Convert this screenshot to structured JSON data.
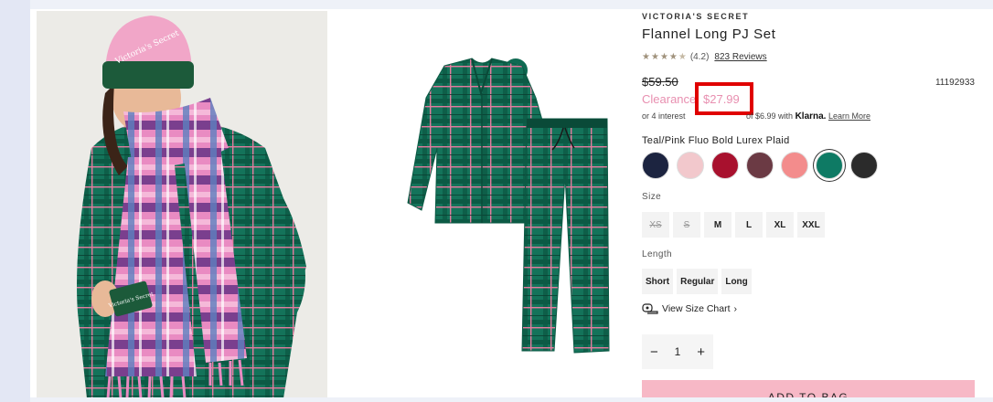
{
  "product": {
    "brand": "VICTORIA'S SECRET",
    "title": "Flannel Long PJ Set",
    "rating_value": 4.2,
    "rating_text": "(4.2)",
    "reviews_link": "823 Reviews",
    "original_price": "$59.50",
    "sku": "11192933",
    "clearance_label": "Clearance",
    "sale_price": "$27.99",
    "klarna_pre": "or 4 interest",
    "klarna_post": "of $6.99 with",
    "klarna_brand": "Klarna.",
    "klarna_learn": "Learn More",
    "selected_color": "Teal/Pink Fluo Bold Lurex Plaid"
  },
  "swatches": [
    {
      "name": "navy-star",
      "color": "#1c2440",
      "selected": false
    },
    {
      "name": "pink-stripe",
      "color": "#f2c8cc",
      "selected": false
    },
    {
      "name": "red-plaid",
      "color": "#a8112e",
      "selected": false
    },
    {
      "name": "burgundy-plaid",
      "color": "#6b3a44",
      "selected": false
    },
    {
      "name": "pink-red-plaid",
      "color": "#f38c8c",
      "selected": false
    },
    {
      "name": "teal-pink-plaid",
      "color": "#0e7a64",
      "selected": true
    },
    {
      "name": "black-white-plaid",
      "color": "#2b2b2b",
      "selected": false
    }
  ],
  "size_label": "Size",
  "sizes": [
    {
      "label": "XS",
      "available": false
    },
    {
      "label": "S",
      "available": false
    },
    {
      "label": "M",
      "available": true
    },
    {
      "label": "L",
      "available": true
    },
    {
      "label": "XL",
      "available": true
    },
    {
      "label": "XXL",
      "available": true
    }
  ],
  "length_label": "Length",
  "lengths": [
    "Short",
    "Regular",
    "Long"
  ],
  "size_chart_link": "View Size Chart",
  "size_chart_chevron": "›",
  "quantity": {
    "minus": "−",
    "value": "1",
    "plus": "+"
  },
  "add_to_bag": "ADD TO BAG",
  "images": {
    "beanie_text": "Victoria's Secret",
    "scarf_patch_text": "Victoria's Secret"
  },
  "colors": {
    "accent_pink": "#e88fb0",
    "highlight_red": "#e00000",
    "add_bag_pink": "#f7b8c6",
    "plaid_green": "#127a5e"
  }
}
